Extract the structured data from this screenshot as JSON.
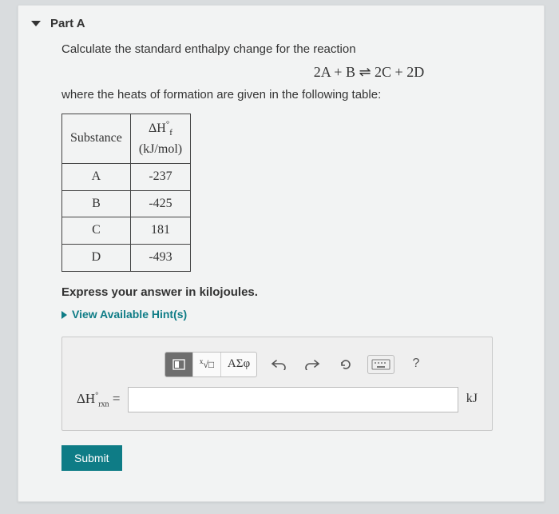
{
  "part": {
    "label": "Part A"
  },
  "prompt": {
    "line1": "Calculate the standard enthalpy change for the reaction",
    "equation": "2A + B ⇌ 2C + 2D",
    "line2": "where the heats of formation are given in the following table:"
  },
  "table": {
    "headers": {
      "substance": "Substance",
      "hf_html": "ΔH°f",
      "hf_units": "(kJ/mol)"
    },
    "rows": [
      {
        "substance": "A",
        "value": "-237"
      },
      {
        "substance": "B",
        "value": "-425"
      },
      {
        "substance": "C",
        "value": "181"
      },
      {
        "substance": "D",
        "value": "-493"
      }
    ]
  },
  "instruction": "Express your answer in kilojoules.",
  "hints": {
    "label": "View Available Hint(s)"
  },
  "toolbar": {
    "template": "template-icon",
    "root": "nth-root-icon",
    "greek": "ΑΣφ",
    "undo": "undo-icon",
    "redo": "redo-icon",
    "reset": "reset-icon",
    "keyboard": "keyboard-icon",
    "help": "?"
  },
  "answer": {
    "lhs": "ΔH°rxn =",
    "value": "",
    "unit": "kJ"
  },
  "submit": {
    "label": "Submit"
  }
}
